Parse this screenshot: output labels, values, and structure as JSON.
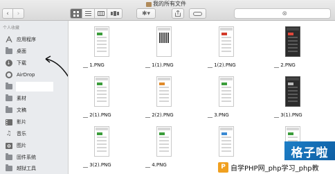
{
  "window": {
    "title": "我的所有文件"
  },
  "toolbar": {
    "back_icon": "chevron-left-icon",
    "forward_icon": "chevron-right-icon",
    "view_modes": [
      "icon-view",
      "list-view",
      "column-view",
      "cover-flow-view"
    ],
    "arrange_icon": "gear-icon",
    "search_placeholder": "⊗"
  },
  "sidebar": {
    "section_title": "个人收藏",
    "items": [
      {
        "icon": "applications-icon",
        "label": "应用程序"
      },
      {
        "icon": "desktop-icon",
        "label": "桌面"
      },
      {
        "icon": "download-icon",
        "label": "下载"
      },
      {
        "icon": "airdrop-icon",
        "label": "AirDrop"
      },
      {
        "icon": "folder-icon",
        "label": ""
      },
      {
        "icon": "folder-icon",
        "label": "素材"
      },
      {
        "icon": "documents-icon",
        "label": "文稿"
      },
      {
        "icon": "movies-icon",
        "label": "影片"
      },
      {
        "icon": "music-icon",
        "label": "音乐"
      },
      {
        "icon": "pictures-icon",
        "label": "图片"
      },
      {
        "icon": "folder-icon",
        "label": "固件系统"
      },
      {
        "icon": "folder-icon",
        "label": "越狱工具"
      }
    ]
  },
  "files": [
    {
      "name": "__ 1.PNG",
      "style": "light",
      "accent": "#3a9d3a"
    },
    {
      "name": "__ 1(1).PNG",
      "style": "qr",
      "accent": "#222222"
    },
    {
      "name": "__ 1(2).PNG",
      "style": "light",
      "accent": "#d23a2a"
    },
    {
      "name": "__ 2.PNG",
      "style": "dark",
      "accent": "#e0473a"
    },
    {
      "name": "__ 2(1).PNG",
      "style": "light",
      "accent": "#3a9d3a"
    },
    {
      "name": "__ 2(2).PNG",
      "style": "light",
      "accent": "#e08a2a"
    },
    {
      "name": "__ 3.PNG",
      "style": "light",
      "accent": "#3a9d3a"
    },
    {
      "name": "__ 3(1).PNG",
      "style": "dark",
      "accent": "#bbbbbb"
    },
    {
      "name": "__ 3(2).PNG",
      "style": "light",
      "accent": "#3a9d3a"
    },
    {
      "name": "__ 4.PNG",
      "style": "light",
      "accent": "#3a9d3a"
    },
    {
      "name": "",
      "style": "light",
      "accent": "#3a8ad3"
    },
    {
      "name": "",
      "style": "light",
      "accent": "#3a9d3a"
    }
  ],
  "watermarks": {
    "corner_text": "格子啦",
    "bottom_logo": "P",
    "bottom_text": "自学PHP网_php学习_php教"
  }
}
